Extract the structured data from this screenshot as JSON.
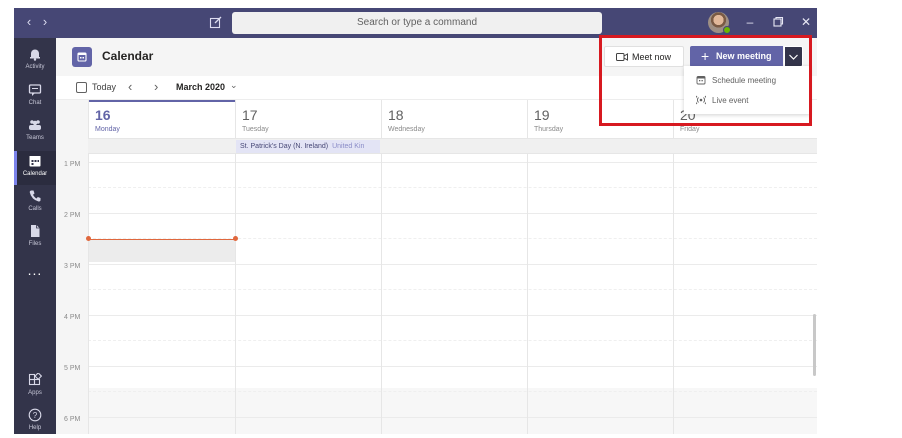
{
  "topbar": {
    "search_placeholder": "Search or type a command",
    "back_icon": "chevron-left-icon",
    "forward_icon": "chevron-right-icon",
    "compose_icon": "compose-icon",
    "window_controls": [
      "minimize",
      "restore",
      "close"
    ]
  },
  "rail": {
    "items": [
      {
        "label": "Activity",
        "icon": "bell-icon"
      },
      {
        "label": "Chat",
        "icon": "chat-icon"
      },
      {
        "label": "Teams",
        "icon": "teams-icon"
      },
      {
        "label": "Calendar",
        "icon": "calendar-icon",
        "active": true
      },
      {
        "label": "Calls",
        "icon": "phone-icon"
      },
      {
        "label": "Files",
        "icon": "file-icon"
      }
    ],
    "more": "...",
    "bottom": [
      {
        "label": "Apps",
        "icon": "apps-icon"
      },
      {
        "label": "Help",
        "icon": "help-icon"
      }
    ]
  },
  "calendar": {
    "title": "Calendar",
    "today_label": "Today",
    "month_label": "March 2020",
    "meet_now_label": "Meet now",
    "new_meeting_label": "New meeting",
    "dropdown": [
      {
        "label": "Schedule meeting",
        "icon": "calendar-small-icon"
      },
      {
        "label": "Live event",
        "icon": "broadcast-icon"
      }
    ],
    "days": [
      {
        "num": "16",
        "name": "Monday",
        "today": true
      },
      {
        "num": "17",
        "name": "Tuesday"
      },
      {
        "num": "18",
        "name": "Wednesday"
      },
      {
        "num": "19",
        "name": "Thursday"
      },
      {
        "num": "20",
        "name": "Friday"
      }
    ],
    "allday_event": {
      "title": "St. Patrick's Day (N. Ireland)",
      "subtitle": "United Kin"
    },
    "times": [
      "1 PM",
      "2 PM",
      "3 PM",
      "4 PM",
      "5 PM",
      "6 PM"
    ]
  },
  "colors": {
    "brand": "#6264a7",
    "topbar": "#464775",
    "rail": "#33344a",
    "now_line": "#e0683e",
    "highlight": "#d71920"
  }
}
